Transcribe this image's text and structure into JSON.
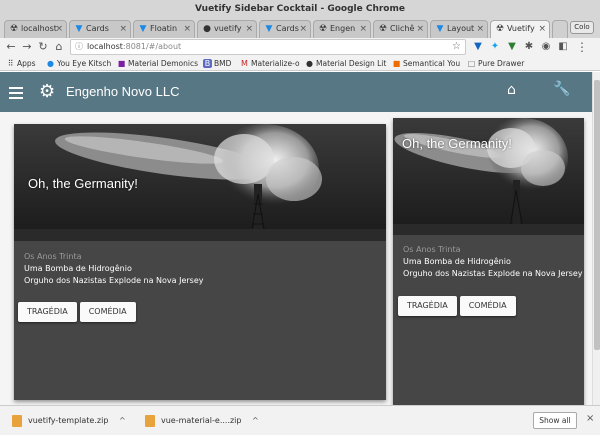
{
  "window": {
    "title": "Vuetify Sidebar Cocktail - Google Chrome"
  },
  "tabs": [
    {
      "label": "localhost",
      "icon": "☢"
    },
    {
      "label": "Cards",
      "icon": "▼"
    },
    {
      "label": "Floatin",
      "icon": "▼"
    },
    {
      "label": "vuetify",
      "icon": "●"
    },
    {
      "label": "Cards",
      "icon": "▼"
    },
    {
      "label": "Engen",
      "icon": "☢"
    },
    {
      "label": "Clichê",
      "icon": "☢"
    },
    {
      "label": "Layout",
      "icon": "▼"
    },
    {
      "label": "Vuetify",
      "icon": "☢"
    }
  ],
  "user_chip": "Colo",
  "address": {
    "host": "localhost",
    "path": ":8081/#/about"
  },
  "bookmarks": [
    {
      "label": "Apps",
      "icon": "⠿"
    },
    {
      "label": "You Eye Kitsch",
      "icon": "●"
    },
    {
      "label": "Material Demonics",
      "icon": "■"
    },
    {
      "label": "BMD",
      "icon": "B"
    },
    {
      "label": "Materialize-o",
      "icon": "M"
    },
    {
      "label": "Material Design Lit",
      "icon": "●"
    },
    {
      "label": "Semantical You",
      "icon": "■"
    },
    {
      "label": "Pure Drawer",
      "icon": "□"
    }
  ],
  "app": {
    "title": "Engenho Novo LLC"
  },
  "cards": [
    {
      "headline": "Oh, the Germanity!",
      "subtitle": "Os Anos Trinta",
      "line1": "Uma Bomba de Hidrogênio",
      "line2": "Orguho dos Nazistas Explode na Nova Jersey",
      "btn1": "TRAGÉDIA",
      "btn2": "COMÉDIA"
    },
    {
      "headline": "Oh, the Germanity!",
      "subtitle": "Os Anos Trinta",
      "line1": "Uma Bomba de Hidrogênio",
      "line2": "Orguho dos Nazistas Explode na Nova Jersey",
      "btn1": "TRAGÉDIA",
      "btn2": "COMÉDIA"
    }
  ],
  "downloads": [
    {
      "name": "vuetify-template.zip"
    },
    {
      "name": "vue-material-e....zip"
    }
  ],
  "shelf": {
    "show_all": "Show all"
  }
}
